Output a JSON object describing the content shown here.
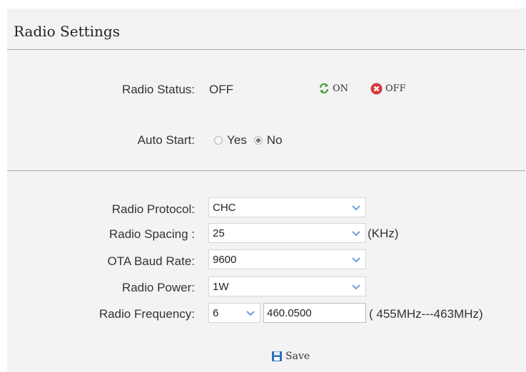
{
  "page": {
    "title": "Radio Settings"
  },
  "status": {
    "label": "Radio Status:",
    "value": "OFF",
    "on_label": "ON",
    "off_label": "OFF"
  },
  "auto_start": {
    "label": "Auto Start:",
    "options": [
      {
        "label": "Yes",
        "checked": false
      },
      {
        "label": "No",
        "checked": true
      }
    ]
  },
  "protocol": {
    "label": "Radio Protocol:",
    "value": "CHC"
  },
  "spacing": {
    "label": "Radio Spacing :",
    "value": "25",
    "unit": "(KHz)"
  },
  "baud": {
    "label": "OTA Baud Rate:",
    "value": "9600"
  },
  "power": {
    "label": "Radio Power:",
    "value": "1W"
  },
  "frequency": {
    "label": "Radio Frequency:",
    "channel": "6",
    "value": "460.0500",
    "range": "(   455MHz---463MHz)"
  },
  "save": {
    "label": "Save"
  },
  "colors": {
    "chevron": "#6fa0d8",
    "on_icon": "#4a9a3a",
    "off_icon": "#d83a3a",
    "save_icon": "#2f6fb6"
  }
}
